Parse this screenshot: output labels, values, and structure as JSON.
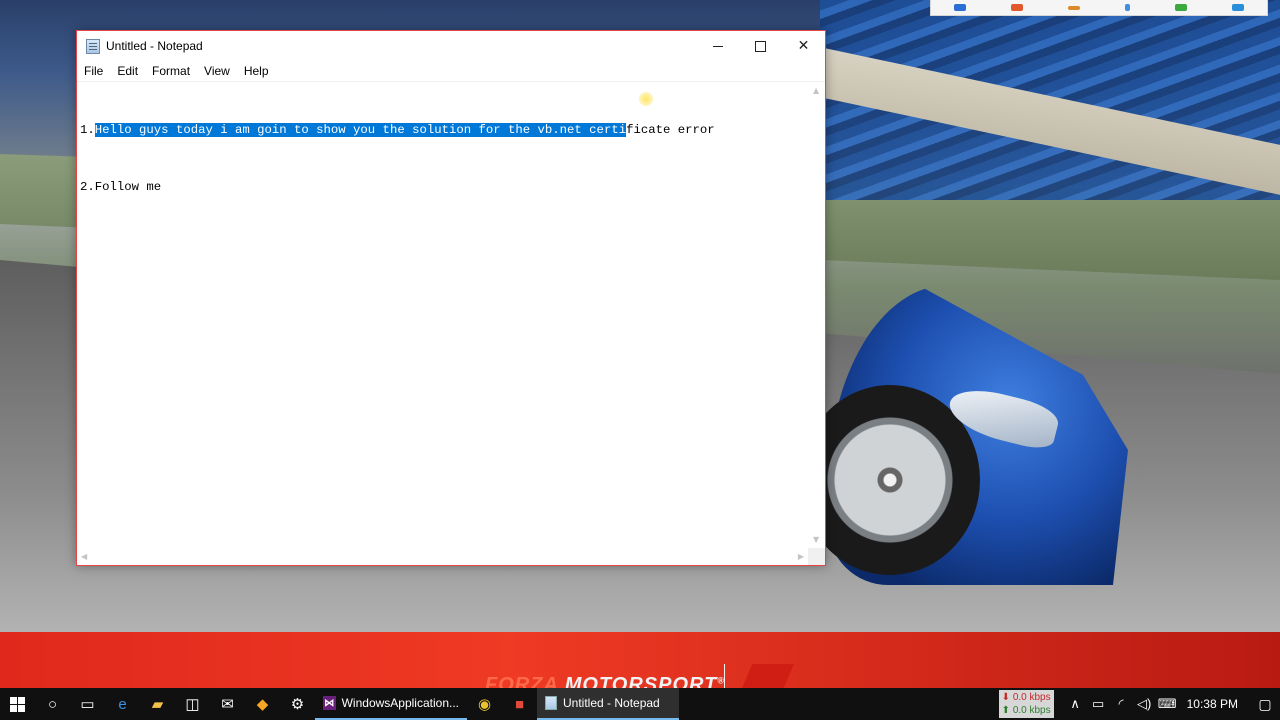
{
  "wallpaper": {
    "brand_prefix": "FORZA",
    "brand_suffix": " MOTORSPORT",
    "brand_mark": "®"
  },
  "notepad": {
    "title": "Untitled - Notepad",
    "menu": [
      "File",
      "Edit",
      "Format",
      "View",
      "Help"
    ],
    "lines": [
      {
        "prefix": "1.",
        "selected": "Hello guys today i am goin to show you the solution for the vb.net certi",
        "rest": "ficate error"
      },
      {
        "prefix": "2.",
        "selected": "",
        "rest": "Follow me"
      }
    ],
    "controls": {
      "minimize": "",
      "maximize": "",
      "close": "✕"
    }
  },
  "taskbar": {
    "apps": [
      {
        "label": "WindowsApplication...",
        "icon": "visual-studio-icon",
        "active": false
      },
      {
        "label": "Untitled - Notepad",
        "icon": "notepad-icon",
        "active": true
      }
    ],
    "network": {
      "down": "0.0 kbps",
      "up": "0.0 kbps"
    },
    "clock": "10:38 PM"
  },
  "colors": {
    "selection": "#0078d7",
    "taskbar": "#101010",
    "window_border": "#e64545",
    "banner": "#e0281c"
  }
}
